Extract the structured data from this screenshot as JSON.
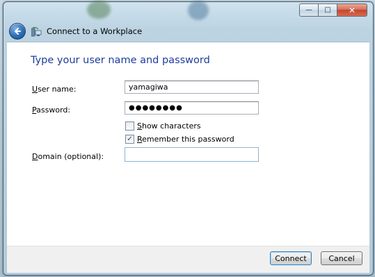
{
  "window": {
    "controls": {
      "minimize": "—",
      "maximize": "□",
      "close": "✕"
    }
  },
  "nav": {
    "title": "Connect to a Workplace",
    "back_icon": "back-arrow-icon",
    "app_icon": "network-connection-icon"
  },
  "content": {
    "heading": "Type your user name and password",
    "username": {
      "label_accel": "U",
      "label_rest": "ser name:",
      "value": "yamagiwa"
    },
    "password": {
      "label_accel": "P",
      "label_rest": "assword:",
      "value": "●●●●●●●●"
    },
    "show_characters": {
      "accel": "S",
      "rest": "how characters",
      "checked": false
    },
    "remember_password": {
      "accel": "R",
      "rest": "emember this password",
      "checked": true,
      "mark": "✓"
    },
    "domain": {
      "label_accel": "D",
      "label_rest": "omain (optional):",
      "value": ""
    }
  },
  "footer": {
    "connect_label": "Connect",
    "cancel_label": "Cancel"
  },
  "colors": {
    "heading": "#1e3d9c",
    "accent": "#2d6db5"
  }
}
